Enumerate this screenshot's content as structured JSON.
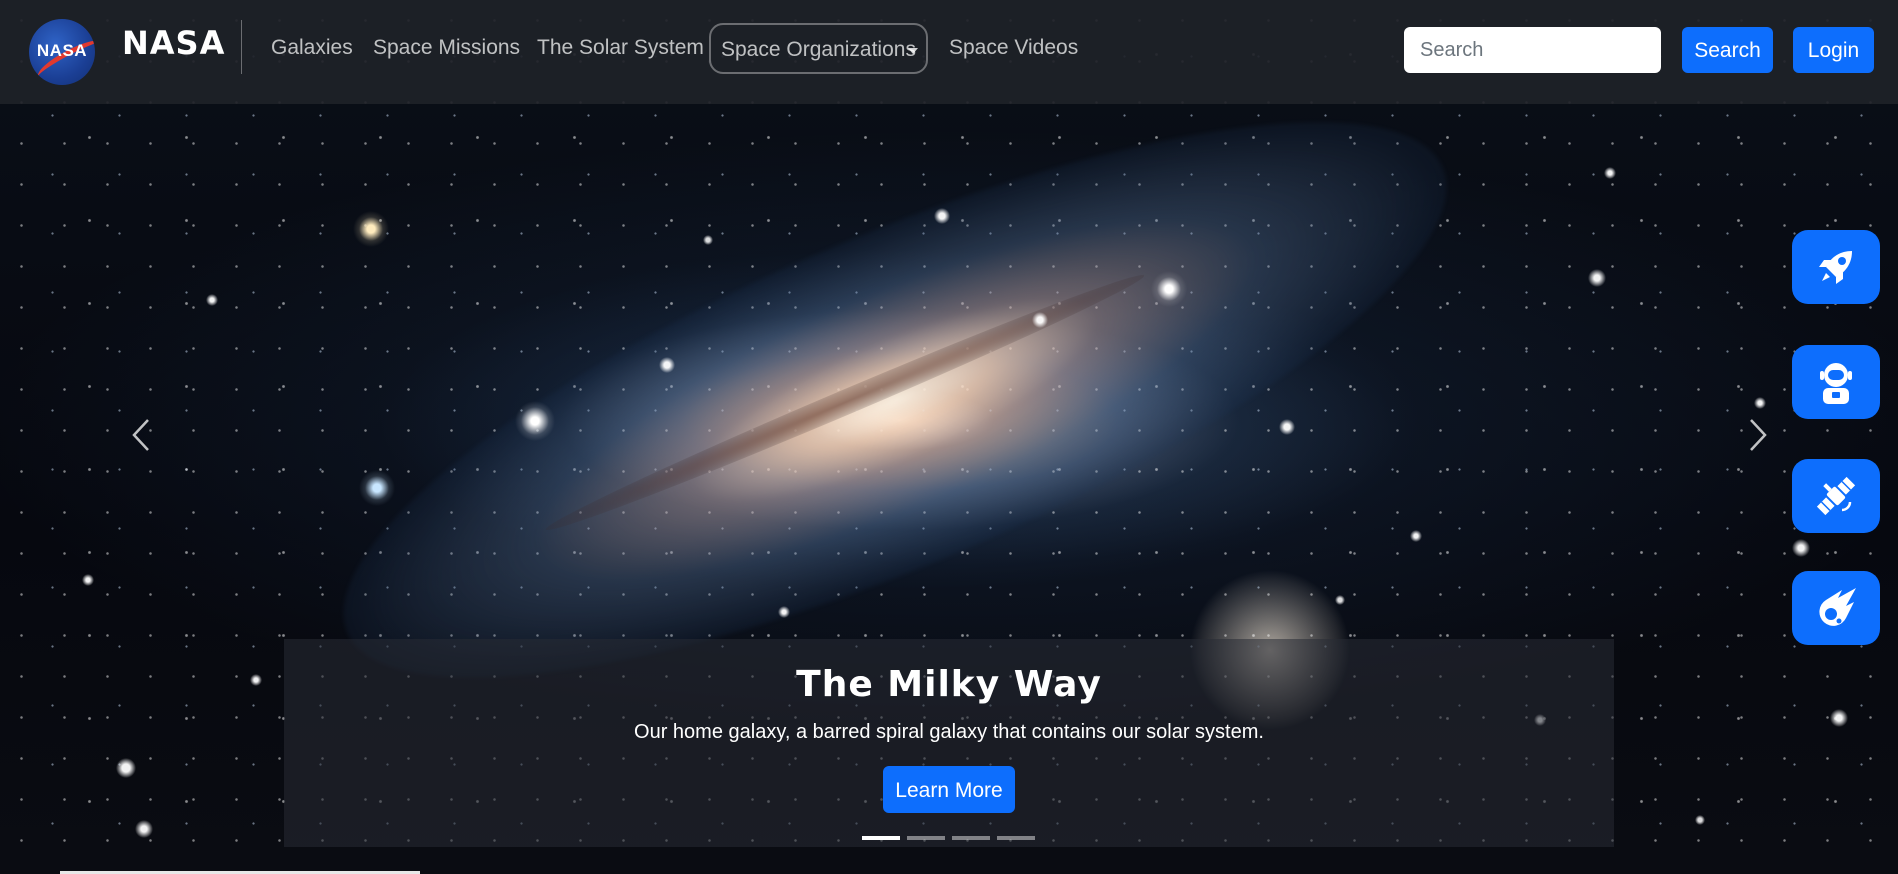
{
  "brand": {
    "logo_text": "NASA",
    "name": "NASA"
  },
  "nav": {
    "links": [
      "Galaxies",
      "Space Missions",
      "The Solar System"
    ],
    "dropdown_label": "Space Organizations",
    "last_link": "Space Videos"
  },
  "search": {
    "placeholder": "Search",
    "button_label": "Search"
  },
  "login_label": "Login",
  "carousel": {
    "title": "The Milky Way",
    "text": "Our home galaxy, a barred spiral galaxy that contains our solar system.",
    "button_label": "Learn More",
    "slide_count": 4,
    "active_index": 0
  },
  "side_buttons": [
    "rocket-icon",
    "astronaut-icon",
    "satellite-icon",
    "meteor-icon"
  ],
  "colors": {
    "accent": "#0d6efd",
    "navbar_bg": "#1e2228"
  }
}
